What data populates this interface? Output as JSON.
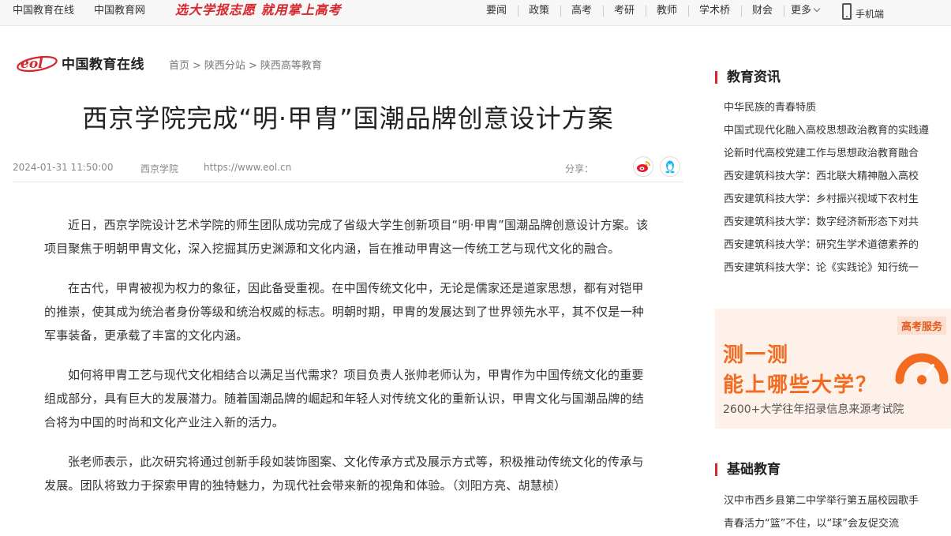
{
  "topbar": {
    "site1": "中国教育在线",
    "site2": "中国教育网",
    "slogan": "选大学报志愿 就用掌上高考",
    "nav": [
      "要闻",
      "政策",
      "高考",
      "考研",
      "教师",
      "学术桥",
      "财会",
      "更多"
    ],
    "mobile": "手机端"
  },
  "header": {
    "logo_mark": "eol",
    "logo_text": "中国教育在线",
    "breadcrumb": [
      "首页",
      "陕西分站",
      "陕西高等教育"
    ],
    "breadcrumb_sep": ">"
  },
  "article": {
    "title": "西京学院完成“明·甲胄”国潮品牌创意设计方案",
    "datetime": "2024-01-31 11:50:00",
    "source": "西京学院",
    "url": "https://www.eol.cn",
    "share_label": "分享：",
    "paragraphs": [
      "近日，西京学院设计艺术学院的师生团队成功完成了省级大学生创新项目“明·甲胄”国潮品牌创意设计方案。该项目聚焦于明朝甲胄文化，深入挖掘其历史渊源和文化内涵，旨在推动甲胄这一传统工艺与现代文化的融合。",
      "在古代，甲胄被视为权力的象征，因此备受重视。在中国传统文化中，无论是儒家还是道家思想，都有对铠甲的推崇，使其成为统治者身份等级和统治权威的标志。明朝时期，甲胄的发展达到了世界领先水平，其不仅是一种军事装备，更承载了丰富的文化内涵。",
      "如何将甲胄工艺与现代文化相结合以满足当代需求？项目负责人张帅老师认为，甲胄作为中国传统文化的重要组成部分，具有巨大的发展潜力。随着国潮品牌的崛起和年轻人对传统文化的重新认识，甲胄文化与国潮品牌的结合将为中国的时尚和文化产业注入新的活力。",
      "张老师表示，此次研究将通过创新手段如装饰图案、文化传承方式及展示方式等，积极推动传统文化的传承与发展。团队将致力于探索甲胄的独特魅力，为现代社会带来新的视角和体验。（刘阳方亮、胡慧桢）"
    ]
  },
  "sidebar": {
    "news_title": "教育资讯",
    "news": [
      "中华民族的青春特质",
      "中国式现代化融入高校思想政治教育的实践遵",
      "论新时代高校党建工作与思想政治教育融合",
      "西安建筑科技大学：西北联大精神融入高校",
      "西安建筑科技大学：乡村振兴视域下农村生",
      "西安建筑科技大学：数字经济新形态下对共",
      "西安建筑科技大学：研究生学术道德素养的",
      "西安建筑科技大学：论《实践论》知行统一"
    ],
    "ad": {
      "badge": "高考服务",
      "line1": "测一测",
      "line2": "能上哪些大学？",
      "sub": "2600+大学往年招录信息来源考试院"
    },
    "basic_title": "基础教育",
    "basic": [
      "汉中市西乡县第二中学举行第五届校园歌手",
      "青春活力“篮”不住，以“球”会友促交流"
    ]
  },
  "colors": {
    "brand_red": "#d7262c",
    "ad_orange": "#f26b21",
    "weibo": "#e6162d",
    "qq": "#12b7f5"
  }
}
